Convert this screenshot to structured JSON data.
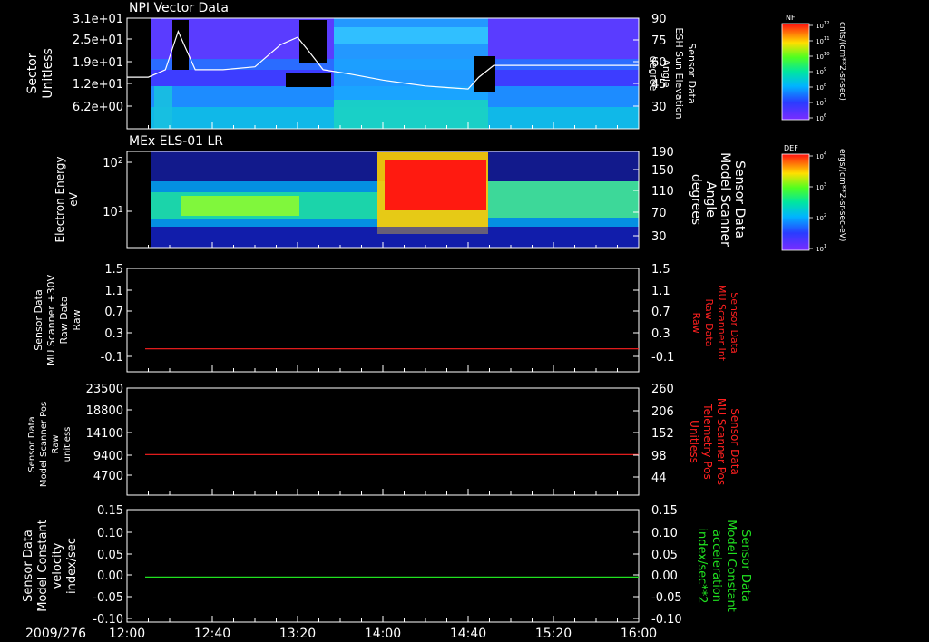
{
  "colors": {
    "background": "#000000",
    "axes": "#ffffff",
    "red_line": "#ff2020",
    "green_line": "#20e020",
    "white_line": "#ffffff"
  },
  "x_axis": {
    "date_label": "2009/276",
    "ticks": [
      "12:00",
      "12:40",
      "13:20",
      "14:00",
      "14:40",
      "15:20",
      "16:00"
    ]
  },
  "chart_data": [
    {
      "type": "heatmap",
      "title": "NPI Vector Data",
      "ylabel_lines": [
        "Sector",
        "Unitless"
      ],
      "y_ticks": [
        "3.1e+01",
        "2.5e+01",
        "1.9e+01",
        "1.2e+01",
        "6.2e+00"
      ],
      "right_ylabel_lines": [
        "Sensor Data",
        "ESH Sun Elevation",
        "Angle",
        "degree"
      ],
      "right_ticks": [
        "90",
        "75",
        "60",
        "45",
        "30"
      ],
      "right_ylim": [
        15,
        90
      ],
      "overlay_series": {
        "name": "ESH Sun Elevation Angle",
        "x": [
          "12:00",
          "12:10",
          "12:18",
          "12:24",
          "12:32",
          "12:45",
          "13:00",
          "13:12",
          "13:20",
          "13:25",
          "13:32",
          "13:45",
          "14:00",
          "14:10",
          "14:20",
          "14:30",
          "14:40",
          "14:45",
          "14:52",
          "15:00",
          "16:00"
        ],
        "y": [
          50,
          50,
          55,
          81,
          55,
          55,
          57,
          72,
          77,
          68,
          55,
          52,
          48,
          46,
          44,
          43,
          42,
          50,
          58,
          58,
          58
        ]
      },
      "colorbar": {
        "label": "NF",
        "units": "cnts/(cm**2-sr-sec)",
        "ticks": [
          "10^12",
          "10^11",
          "10^10",
          "10^9",
          "10^8",
          "10^7",
          "10^6"
        ]
      }
    },
    {
      "type": "heatmap",
      "title": "MEx ELS-01 LR",
      "ylabel_lines": [
        "Electron Energy",
        "eV"
      ],
      "y_ticks": [
        "10^2",
        "10^1"
      ],
      "right_ylabel_lines": [
        "Sensor Data",
        "Model Scanner",
        "Angle",
        "degrees"
      ],
      "right_ticks": [
        "190",
        "150",
        "110",
        "70",
        "30"
      ],
      "colorbar": {
        "label": "DEF",
        "units": "ergs/(cm**2-sr-sec-eV)",
        "ticks": [
          "10^4",
          "10^3",
          "10^2",
          "10^1"
        ]
      }
    },
    {
      "type": "line",
      "ylabel_lines": [
        "Sensor Data",
        "MU Scanner +30V",
        "Raw Data",
        "Raw"
      ],
      "y_ticks": [
        "1.5",
        "1.1",
        "0.7",
        "0.3",
        "-0.1"
      ],
      "ylim": [
        -0.3,
        1.5
      ],
      "right_ylabel_lines": [
        "Sensor Data",
        "MU Scanner Int",
        "Raw Data",
        "Raw"
      ],
      "right_ticks": [
        "1.5",
        "1.1",
        "0.7",
        "0.3",
        "-0.1"
      ],
      "series": [
        {
          "x": [
            "12:00",
            "16:00"
          ],
          "y": [
            0.1,
            0.1
          ],
          "color": "#ff2020"
        }
      ]
    },
    {
      "type": "line",
      "ylabel_lines": [
        "Sensor Data",
        "Model Scanner Pos",
        "Raw",
        "unitless"
      ],
      "y_ticks": [
        "23500",
        "18800",
        "14100",
        "9400",
        "4700"
      ],
      "ylim": [
        0,
        23500
      ],
      "right_ylabel_lines": [
        "Sensor Data",
        "MU Scanner Pos",
        "Telemetry Pos",
        "Unitless"
      ],
      "right_ticks": [
        "260",
        "206",
        "152",
        "98",
        "44"
      ],
      "series": [
        {
          "x": [
            "12:00",
            "16:00"
          ],
          "y": [
            8900,
            8900
          ],
          "color": "#ff2020"
        }
      ]
    },
    {
      "type": "line",
      "ylabel_lines": [
        "Sensor Data",
        "Model Constant",
        "velocity",
        "index/sec"
      ],
      "y_ticks": [
        "0.15",
        "0.10",
        "0.05",
        "0.00",
        "-0.05",
        "-0.10"
      ],
      "ylim": [
        -0.1,
        0.15
      ],
      "right_ylabel_lines": [
        "Sensor Data",
        "Model Constant",
        "acceleration",
        "index/sec**2"
      ],
      "right_ticks": [
        "0.15",
        "0.10",
        "0.05",
        "0.00",
        "-0.05",
        "-0.10"
      ],
      "series": [
        {
          "x": [
            "12:00",
            "16:00"
          ],
          "y": [
            0.0,
            0.0
          ],
          "color": "#20e020"
        }
      ]
    }
  ]
}
